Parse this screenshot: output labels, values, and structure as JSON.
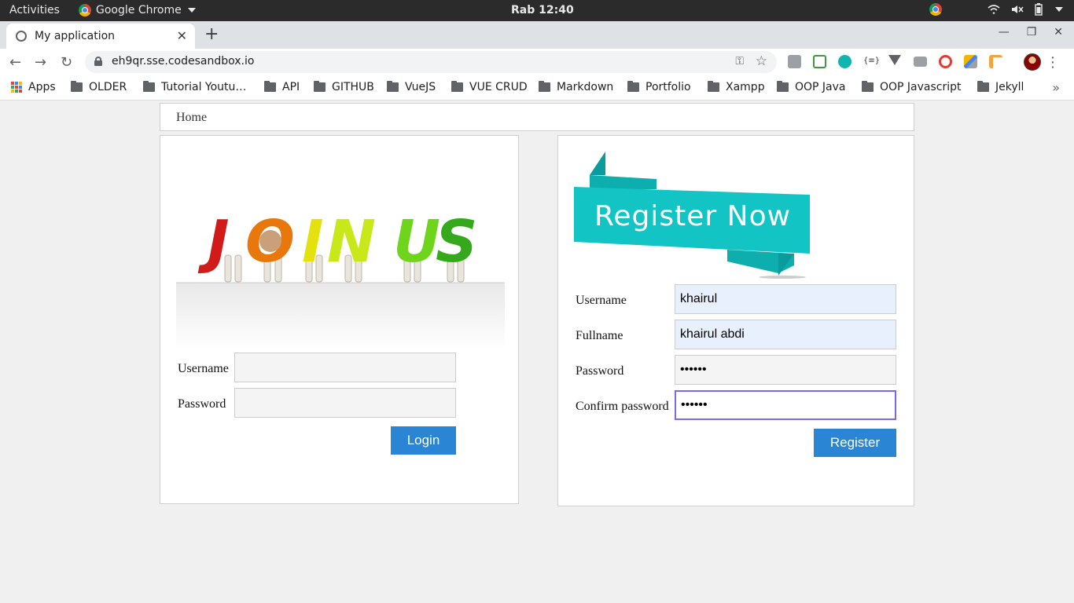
{
  "os": {
    "activities": "Activities",
    "app_name": "Google Chrome",
    "clock": "Rab 12:40"
  },
  "browser": {
    "tab_title": "My application",
    "url": "eh9qr.sse.codesandbox.io",
    "bookmarks": [
      "Apps",
      "OLDER",
      "Tutorial Youtu…",
      "API",
      "GITHUB",
      "VueJS",
      "VUE CRUD",
      "Markdown",
      "Portfolio",
      "Xampp",
      "OOP Java",
      "OOP Javascript",
      "Jekyll"
    ],
    "more": "»"
  },
  "page": {
    "nav_home": "Home",
    "login": {
      "image_text": "JOIN US",
      "username_label": "Username",
      "password_label": "Password",
      "username_value": "",
      "password_value": "",
      "login_button": "Login"
    },
    "register": {
      "banner_text": "Register Now",
      "username_label": "Username",
      "fullname_label": "Fullname",
      "password_label": "Password",
      "confirm_label": "Confirm password",
      "username_value": "khairul",
      "fullname_value": "khairul abdi",
      "password_value": "••••••",
      "confirm_value": "••••••",
      "register_button": "Register"
    }
  },
  "colors": {
    "accent_button": "#2a85d4",
    "ribbon_teal": "#12c4c4",
    "focus_border": "#7b68ee"
  }
}
